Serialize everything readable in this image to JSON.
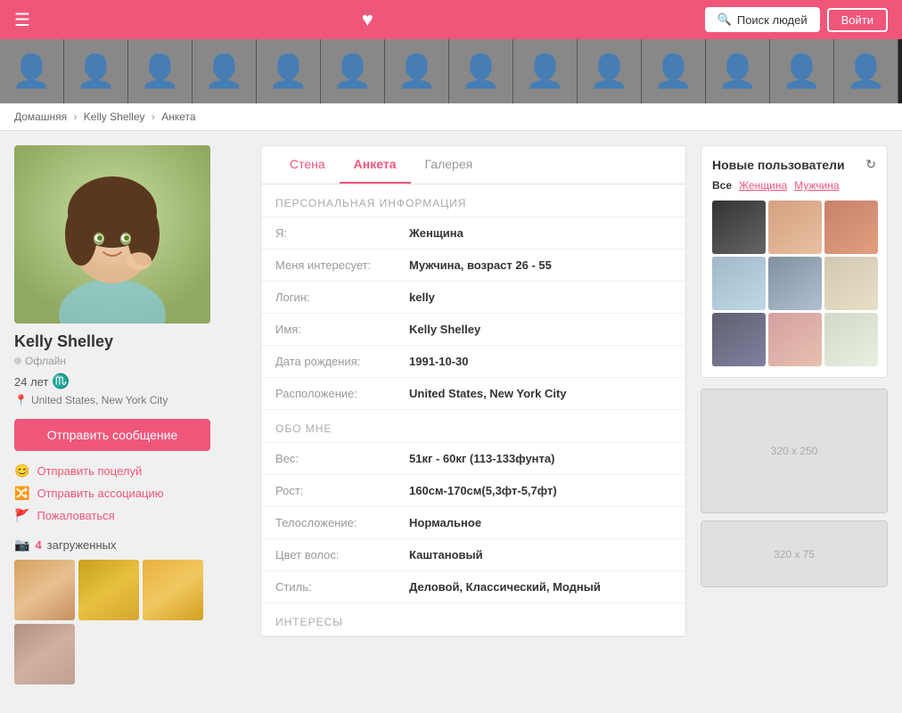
{
  "header": {
    "search_label": "Поиск людей",
    "login_label": "Войти",
    "heart": "♥"
  },
  "breadcrumb": {
    "home": "Домашняя",
    "user": "Kelly Shelley",
    "page": "Анкета"
  },
  "tabs": {
    "wall": "Стена",
    "profile": "Анкета",
    "gallery": "Галерея"
  },
  "user": {
    "name": "Kelly Shelley",
    "status": "Офлайн",
    "age": "24 лет",
    "zodiac": "♏",
    "location": "United States, New York City",
    "send_message": "Отправить сообщение"
  },
  "actions": {
    "kiss": "Отправить поцелуй",
    "association": "Отправить ассоциацию",
    "report": "Пожаловаться"
  },
  "photos": {
    "label": "загруженных",
    "count": "4"
  },
  "personal_info": {
    "section_title": "ПЕРСОНАЛЬНАЯ ИНФОРМАЦИЯ",
    "gender_label": "Я:",
    "gender_value": "Женщина",
    "interested_label": "Меня интересует:",
    "interested_value": "Мужчина, возраст 26 - 55",
    "login_label": "Логин:",
    "login_value": "kelly",
    "name_label": "Имя:",
    "name_value": "Kelly Shelley",
    "birthday_label": "Дата рождения:",
    "birthday_value": "1991-10-30",
    "location_label": "Расположение:",
    "location_value": "United States, New York City"
  },
  "about_me": {
    "section_title": "ОБО МНЕ",
    "weight_label": "Вес:",
    "weight_value": "51кг - 60кг (113-133фунта)",
    "height_label": "Рост:",
    "height_value": "160см-170см(5,3фт-5,7фт)",
    "body_label": "Телосложение:",
    "body_value": "Нормальное",
    "hair_label": "Цвет волос:",
    "hair_value": "Каштановый",
    "style_label": "Стиль:",
    "style_value": "Деловой, Классический, Модный"
  },
  "interests": {
    "section_title": "ИНТЕРЕСЫ"
  },
  "right_sidebar": {
    "new_users_title": "Новые пользователи",
    "filter_all": "Все",
    "filter_female": "Женщина",
    "filter_male": "Мужчина",
    "ad_large": "320 x 250",
    "ad_small": "320 x 75"
  }
}
